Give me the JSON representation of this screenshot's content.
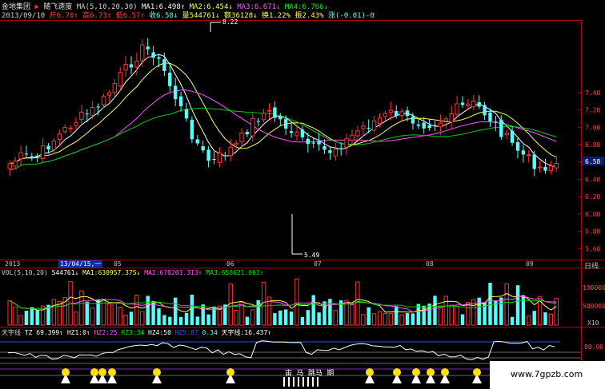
{
  "header": {
    "company": "金地集团",
    "stock": "随飞速度",
    "ma_title": "MA(5,10,20,30)",
    "ma1": "MA1:6.498↑",
    "ma2": "MA2:6.454↓",
    "ma3": "MA3:6.671↓",
    "ma4": "MA4:6.766↓",
    "date": "2013/09/10",
    "open": "开6.70↑",
    "high": "高6.73↑",
    "low": "低6.57↑",
    "close": "收6.58↓",
    "volume": "量544761↓",
    "amount": "额36128↓",
    "turnover": "换1.22%",
    "amplitude": "振2.43%",
    "change": "涨(-0.01)-0"
  },
  "price_axis": {
    "labels": [
      "7.40",
      "7.20",
      "7.00",
      "6.80",
      "6.60",
      "6.40",
      "6.20",
      "6.00",
      "5.80",
      "5.60"
    ],
    "current_price": "6.58"
  },
  "annotations": {
    "high_mark": "8.22",
    "low_mark": "5.49"
  },
  "timeline": {
    "year": "2013",
    "selected_date": "13/04/15,一",
    "months": [
      "05",
      "06",
      "07",
      "08",
      "09"
    ],
    "period": "日线"
  },
  "volume_panel": {
    "title": "VOL(5,10,20)",
    "vol": "544761↓",
    "ma1": "MA1:630957.375↓",
    "ma2": "MA2:670201.313↑",
    "ma3": "MA3:658621.063↑",
    "axis": [
      "100000",
      "500000"
    ],
    "unit": "X10"
  },
  "indicator_panel": {
    "name": "天宇线",
    "tz": "TZ 69.399↑",
    "hz1": "HZ1:0↑",
    "hz2": "HZ2:25",
    "hz3": "HZ3:34",
    "hz4": "HZ4:50",
    "hz5": "HZ5:87",
    "zero": "0.34",
    "value": "天宇线:16.437↑",
    "axis": "80.00",
    "bottom_text": "宙 马 跳马 期"
  },
  "watermark": "www.7gpzb.com",
  "colors": {
    "up_candle": "#ff3333",
    "down_candle": "#54ffff",
    "ma5": "#ffffff",
    "ma10": "#ffff54",
    "ma20": "#ff54ff",
    "ma30": "#00cc00"
  }
}
